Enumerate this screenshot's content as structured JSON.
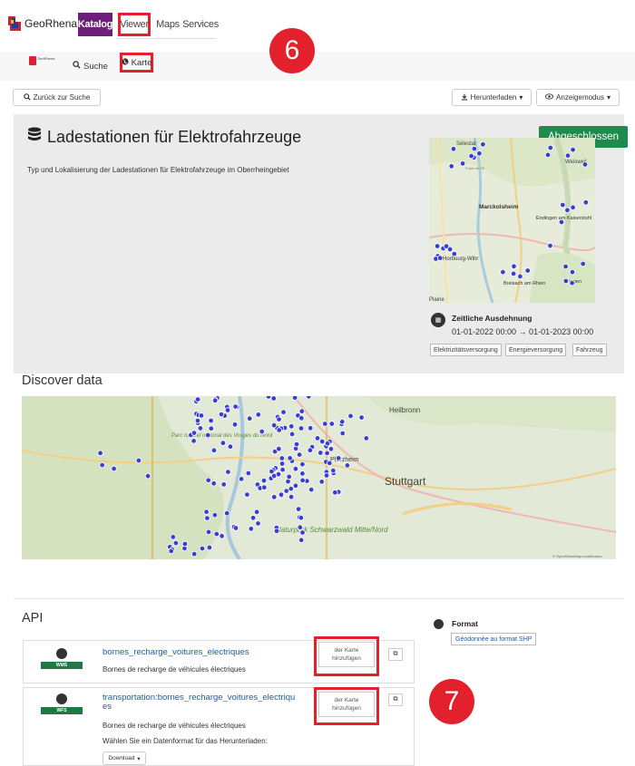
{
  "nav": {
    "logo_text": "GeoRhena",
    "items": [
      {
        "label": "Katalog"
      },
      {
        "label": "Viewer"
      },
      {
        "label": "Maps"
      },
      {
        "label": "Services"
      }
    ]
  },
  "subnav": {
    "mini_logo_text": "GeoRhena",
    "search_label": "Suche",
    "map_label": "Karte"
  },
  "annotations": {
    "step_6": "6",
    "step_7": "7"
  },
  "toolbar": {
    "back_label": "Zurück zur Suche",
    "download_label": "Herunterladen",
    "view_mode_label": "Anzeigemodus"
  },
  "dataset": {
    "title": "Ladestationen für Elektrofahrzeuge",
    "description": "Typ und Lokalisierung der Ladestationen für Elektrofahrzeuge im Oberrheingebiet",
    "status": "Abgeschlossen",
    "thumbnail_places": [
      "Sélestat",
      "Forêt de l'Ill",
      "Weisweil",
      "Marckolsheim",
      "Endingen am Kaiserstuhl",
      "Horbourg-Wihr",
      "Breisach am Rhein",
      "Ihringen",
      "Plaine"
    ],
    "time_extent_label": "Zeitliche Ausdehnung",
    "time_extent_value": "01-01-2022 00:00 → 01-01-2023 00:00",
    "tags": [
      "Elektrizitätsversorgung",
      "Energieversorgung",
      "Fahrzeug"
    ]
  },
  "discover": {
    "heading": "Discover data",
    "map_places": [
      "Heilbronn",
      "Parc naturel régional des Vosges du Nord",
      "Pforzheim",
      "Stuttgart",
      "Naturpark Schwarzwald Mitte/Nord"
    ],
    "attribution": "© OpenStreetMap contributors."
  },
  "api": {
    "heading": "API",
    "format_label": "Format",
    "format_value": "Géodonnée au format SHP",
    "services": [
      {
        "badge": "WMS",
        "name": "bornes_recharge_voitures_electriques",
        "description": "Bornes de recharge de véhicules électriques",
        "add_label": "der Karte hinzufügen"
      },
      {
        "badge": "WFS",
        "name_line1": "transportation:bornes_recharge_voitures_electriqu",
        "name_line2": "es",
        "description": "Bornes de recharge de véhicules électriques",
        "format_hint": "Wählen Sie ein Datenformat für das Herunterladen:",
        "download_label": "Download",
        "add_label": "der Karte hinzufügen"
      }
    ]
  },
  "colors": {
    "brand_purple": "#6d1f7a",
    "status_green": "#1e8a4c",
    "annotation_red": "#e3212c",
    "link_blue": "#1a5bb8",
    "marker_blue": "#3a3fd4"
  }
}
